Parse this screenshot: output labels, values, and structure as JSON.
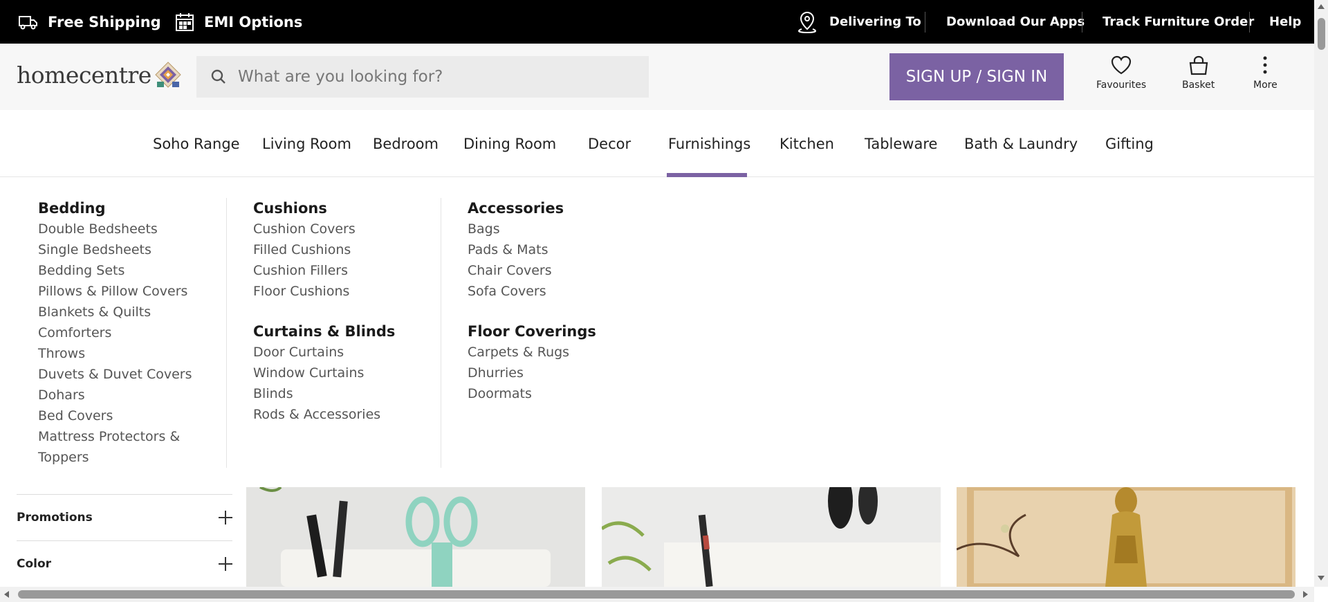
{
  "topbar": {
    "free_shipping": "Free Shipping",
    "emi_options": "EMI Options",
    "delivering_to": "Delivering To",
    "download_apps": "Download Our Apps",
    "track_order": "Track Furniture Order",
    "help": "Help"
  },
  "header": {
    "logo_text": "homecentre",
    "search_placeholder": "What are you looking for?",
    "signin_label": "SIGN UP / SIGN IN",
    "favourites_label": "Favourites",
    "basket_label": "Basket",
    "more_label": "More"
  },
  "nav": {
    "items": [
      "Soho Range",
      "Living Room",
      "Bedroom",
      "Dining Room",
      "Decor",
      "Furnishings",
      "Kitchen",
      "Tableware",
      "Bath & Laundry",
      "Gifting"
    ],
    "active": "Furnishings"
  },
  "mega_menu": {
    "columns": [
      {
        "groups": [
          {
            "title": "Bedding",
            "links": [
              "Double Bedsheets",
              "Single Bedsheets",
              "Bedding Sets",
              "Pillows & Pillow Covers",
              "Blankets & Quilts",
              "Comforters",
              "Throws",
              "Duvets & Duvet Covers",
              "Dohars",
              "Bed Covers",
              "Mattress Protectors &",
              "Toppers"
            ]
          }
        ]
      },
      {
        "groups": [
          {
            "title": "Cushions",
            "links": [
              "Cushion Covers",
              "Filled Cushions",
              "Cushion Fillers",
              "Floor Cushions"
            ]
          },
          {
            "title": "Curtains & Blinds",
            "links": [
              "Door Curtains",
              "Window Curtains",
              "Blinds",
              "Rods & Accessories"
            ]
          }
        ]
      },
      {
        "groups": [
          {
            "title": "Accessories",
            "links": [
              "Bags",
              "Pads & Mats",
              "Chair Covers",
              "Sofa Covers"
            ]
          },
          {
            "title": "Floor Coverings",
            "links": [
              "Carpets & Rugs",
              "Dhurries",
              "Doormats"
            ]
          }
        ]
      }
    ]
  },
  "filters": {
    "promotions": "Promotions",
    "color": "Color"
  },
  "colors": {
    "accent": "#7b62a3",
    "topbar_bg": "#000000",
    "header_bg": "#f7f7f7"
  }
}
